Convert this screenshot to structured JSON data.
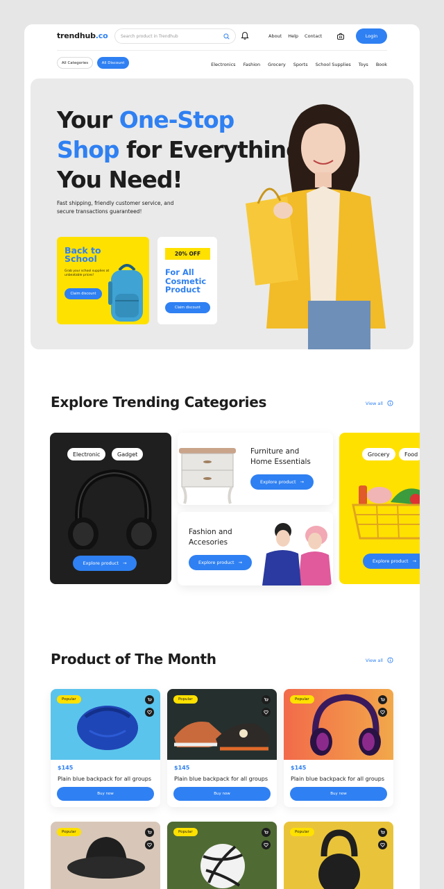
{
  "header": {
    "logo_text": "trendhub",
    "logo_suffix": ".co",
    "search_placeholder": "Search product in Trendhub",
    "links": [
      "About",
      "Help",
      "Contact"
    ],
    "login_label": "Login"
  },
  "filters": {
    "all_categories": "All Categories",
    "all_discount": "All Discount"
  },
  "category_nav": [
    "Electronics",
    "Fashion",
    "Grocery",
    "Sports",
    "School Supplies",
    "Toys",
    "Book"
  ],
  "hero": {
    "line1_a": "Your ",
    "line1_b": "One-Stop",
    "line2_a": "Shop",
    "line2_b": " for Everything",
    "line3": "You Need!",
    "subtitle": "Fast shipping, friendly customer service, and secure transactions guaranteed!",
    "promo1": {
      "title_1": "Back to",
      "title_2": "School",
      "desc": "Grab your school supplies at unbeatable prices!",
      "button": "Claim discount"
    },
    "promo2": {
      "badge": "20% OFF",
      "title_1": "For All",
      "title_2": "Cosmetic",
      "title_3": "Product",
      "button": "Claim discount"
    }
  },
  "trending": {
    "title": "Explore Trending Categories",
    "view_all": "View all",
    "electronic": {
      "tags": [
        "Electronic",
        "Gadget"
      ],
      "button": "Explore product"
    },
    "furniture": {
      "title_1": "Furniture and",
      "title_2": "Home Essentials",
      "button": "Explore product"
    },
    "fashion": {
      "title_1": "Fashion and",
      "title_2": "Accesories",
      "button": "Explore product"
    },
    "grocery": {
      "tags": [
        "Grocery",
        "Food"
      ],
      "button": "Explore product"
    }
  },
  "products_section": {
    "title": "Product of The Month",
    "view_all": "View all",
    "badge": "Popular",
    "items": [
      {
        "price": "$145",
        "name": "Plain blue backpack for all groups",
        "button": "Buy now"
      },
      {
        "price": "$145",
        "name": "Plain blue backpack for all groups",
        "button": "Buy now"
      },
      {
        "price": "$145",
        "name": "Plain blue backpack for all groups",
        "button": "Buy now"
      }
    ]
  },
  "colors": {
    "accent": "#2f80f2",
    "yellow": "#ffe100",
    "dark": "#1d1d1d"
  }
}
